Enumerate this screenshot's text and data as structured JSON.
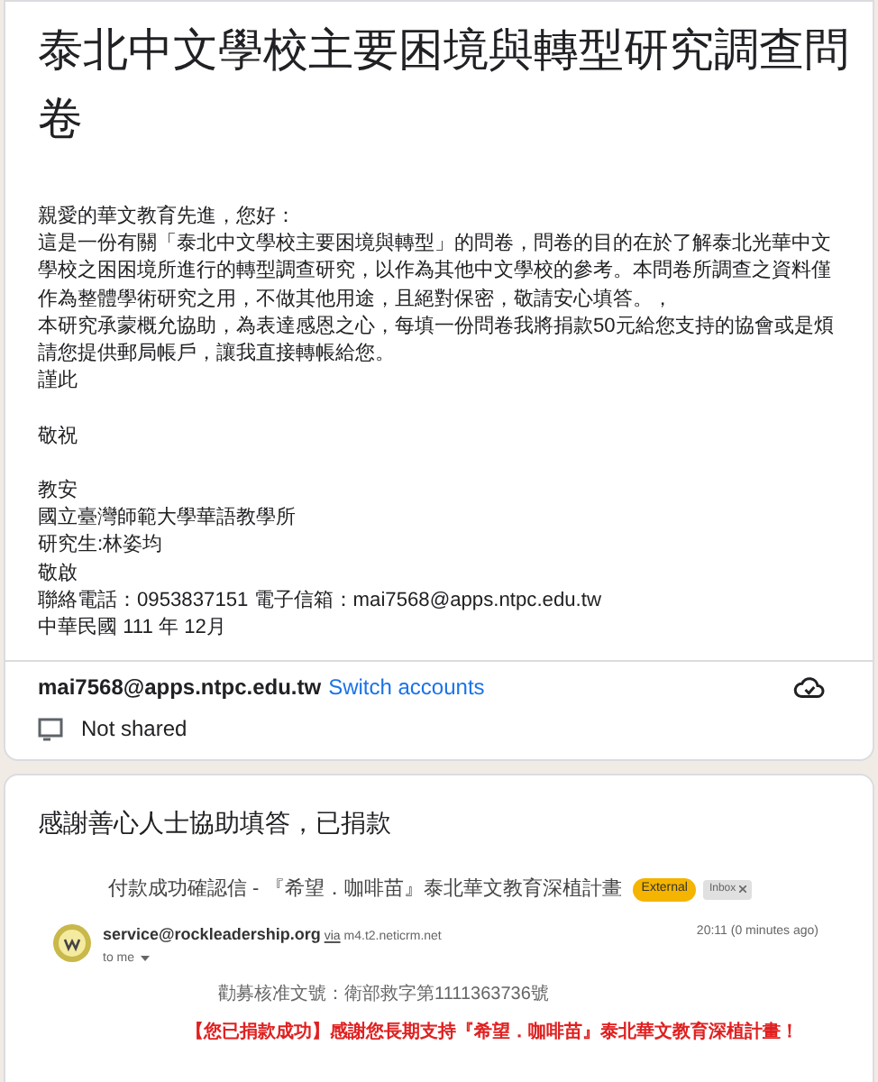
{
  "form": {
    "title": "泰北中文學校主要困境與轉型研究調查問卷",
    "description_blocks": [
      [
        "親愛的華文教育先進，您好：",
        "這是一份有關「泰北中文學校主要困境與轉型」的問卷，問卷的目的在於了解泰北光華中文學校之困困境所進行的轉型調查研究，以作為其他中文學校的參考。本問卷所調查之資料僅作為整體學術研究之用，不做其他用途，且絕對保密，敬請安心填答。，",
        "本研究承蒙概允協助，為表達感恩之心，每填一份問卷我將捐款50元給您支持的協會或是煩請您提供郵局帳戶，讓我直接轉帳給您。",
        "謹此"
      ],
      [
        "敬祝"
      ],
      [
        "教安",
        "國立臺灣師範大學華語教學所",
        "研究生:林姿均",
        "敬啟",
        "聯絡電話：0953837151 電子信箱：mai7568@apps.ntpc.edu.tw",
        "中華民國 111 年 12月"
      ]
    ],
    "account": {
      "email": "mai7568@apps.ntpc.edu.tw",
      "switch_link": "Switch accounts",
      "sharing": "Not shared"
    }
  },
  "section": {
    "title": "感謝善心人士協助填答，已捐款",
    "email": {
      "subject": "付款成功確認信 - 『希望．咖啡苗』泰北華文教育深植計畫",
      "labels": [
        {
          "text": "External",
          "kind": "external"
        },
        {
          "text": "Inbox",
          "kind": "inbox"
        }
      ],
      "sender": "service@rockleadership.org",
      "via_word": "via",
      "via_host": "m4.t2.neticrm.net",
      "time": "20:11 (0 minutes ago)",
      "recipient": "to me",
      "body": [
        {
          "text": "勸募核准文號：衛部救字第1111363736號",
          "kind": "normal"
        },
        {
          "text": "【您已捐款成功】感謝您長期支持『希望．咖啡苗』泰北華文教育深植計畫！",
          "kind": "alert"
        }
      ]
    }
  }
}
